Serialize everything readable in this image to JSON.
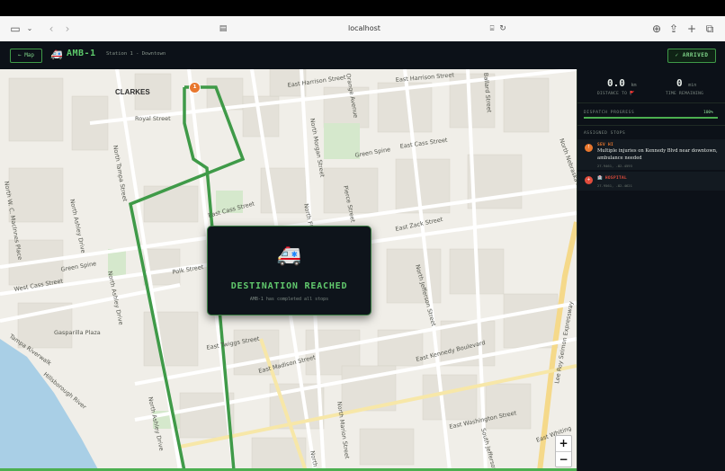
{
  "browser": {
    "url": "localhost",
    "icons": [
      "sidebar-icon",
      "chevron-down-icon",
      "back-icon",
      "forward-icon",
      "tab-icon",
      "translate-icon",
      "reload-icon",
      "download-icon",
      "share-icon",
      "plus-icon",
      "tabs-overview-icon"
    ]
  },
  "header": {
    "back_label": "← Map",
    "unit_emoji": "🚑",
    "unit_name": "AMB-1",
    "station": "Station 1 - Downtown",
    "status_label": "✓ ARRIVED"
  },
  "map": {
    "area_label": "CLARKES",
    "streets": [
      "East Harrison Street",
      "Orange Avenue",
      "East Harrison Street",
      "Ballard Street",
      "Royal Street",
      "East Cass Street",
      "Green Spine",
      "East Cass Street",
      "North Tampa Street",
      "North Florida Avenue",
      "Pierce Street",
      "North Morgan Street",
      "East Zack Street",
      "North Nebraska Avenue",
      "North Ashley Drive",
      "West Cass Street",
      "Green Spine",
      "Gasparilla Plaza",
      "Polk Street",
      "East Twiggs Street",
      "North Jefferson Street",
      "East Kennedy Boulevard",
      "East Madison Street",
      "Lee Roy Selmon Expressway",
      "North Marion Street",
      "East Washington Street",
      "South Jefferson",
      "East Whiting",
      "Tampa Riverwalk",
      "Hillsborough River",
      "North Ashley Drive",
      "North Ashley Drive",
      "North",
      "North W. C. MacInnes Place"
    ],
    "route_marker_label": "1",
    "zoom_in": "+",
    "zoom_out": "−"
  },
  "overlay": {
    "emoji": "🚑",
    "title": "DESTINATION REACHED",
    "subtitle": "AMB-1 has completed all stops"
  },
  "panel": {
    "distance_value": "0.0",
    "distance_unit": "km",
    "distance_label": "DISTANCE TO 🚩",
    "time_value": "0",
    "time_unit": "min",
    "time_label": "TIME REMAINING",
    "progress_label": "DISPATCH PROGRESS",
    "progress_value": "100%",
    "progress_fraction": 1.0,
    "stops_label": "ASSIGNED STOPS",
    "stops": [
      {
        "type": "SEV HI",
        "description": "Multiple injuries on Kennedy Blvd near downtown, ambulance needed",
        "coords": "27.9461, -82.4593",
        "color": "#e8772e"
      },
      {
        "type": "🏥 HOSPITAL",
        "description": "",
        "coords": "27.9561, -82.4621",
        "color": "#e24c3c"
      }
    ]
  },
  "colors": {
    "accent": "#4caf50",
    "panel_bg": "#0c1118",
    "marker": "#e8772e"
  }
}
